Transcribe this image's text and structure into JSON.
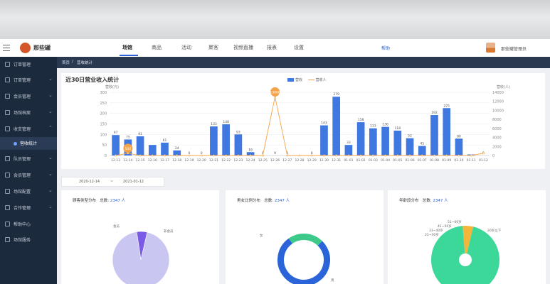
{
  "header": {
    "logo_text": "那些罐",
    "nav": [
      "场馆",
      "商品",
      "活动",
      "聚客",
      "视频直播",
      "报表",
      "设置"
    ],
    "active_nav": 0,
    "help": "帮助",
    "username": "那些罐管理员"
  },
  "sidebar": {
    "items": [
      {
        "label": "订单管理",
        "chevron": false
      },
      {
        "label": "订单管理",
        "chevron": true
      },
      {
        "label": "会员管理",
        "chevron": true
      },
      {
        "label": "场馆档案",
        "chevron": true
      },
      {
        "label": "收支管理",
        "chevron": true
      },
      {
        "label": "营收统计",
        "sub": true
      },
      {
        "label": "队员管理",
        "chevron": true
      },
      {
        "label": "会员管理",
        "chevron": true
      },
      {
        "label": "场馆配置",
        "chevron": true
      },
      {
        "label": "合作管理",
        "chevron": true
      },
      {
        "label": "帮助中心",
        "chevron": false
      },
      {
        "label": "场馆服务",
        "chevron": false
      }
    ]
  },
  "breadcrumb": [
    "首页",
    "营收统计"
  ],
  "main": {
    "title": "近30日营业收入统计",
    "legend": [
      "营收",
      "营收人"
    ],
    "left_unit": "营收(元)",
    "right_unit": "营收(人)"
  },
  "chart_data": {
    "type": "bar",
    "categories": [
      "12-13",
      "12-14",
      "12-15",
      "12-16",
      "12-17",
      "12-18",
      "12-19",
      "12-20",
      "12-21",
      "12-22",
      "12-23",
      "12-24",
      "12-25",
      "12-26",
      "12-27",
      "12-28",
      "12-29",
      "12-30",
      "12-31",
      "01-01",
      "01-02",
      "01-03",
      "01-04",
      "01-05",
      "01-06",
      "01-07",
      "01-08",
      "01-09",
      "01-10",
      "01-11",
      "01-12"
    ],
    "series": [
      {
        "name": "营收",
        "axis": "left",
        "values": [
          97,
          76,
          91,
          50,
          61,
          24,
          0,
          0,
          138,
          148,
          100,
          16,
          0,
          0,
          0,
          0,
          0,
          143,
          279,
          50,
          158,
          129,
          136,
          118,
          82,
          45,
          192,
          225,
          80,
          5,
          0
        ],
        "labels": [
          "97",
          "75",
          "91",
          "",
          "61",
          "24",
          "0",
          "0",
          "133",
          "148",
          "93",
          "16",
          "0",
          "9",
          "0",
          "",
          "8",
          "143",
          "279",
          "33",
          "158",
          "113",
          "136",
          "118",
          "52",
          "45",
          "192",
          "225",
          "80",
          "",
          "0"
        ]
      },
      {
        "name": "营收人",
        "axis": "right",
        "values": [
          0,
          500,
          0,
          0,
          0,
          0,
          0,
          0,
          0,
          0,
          0,
          0,
          0,
          13000,
          0,
          0,
          0,
          0,
          0,
          0,
          0,
          0,
          0,
          0,
          0,
          0,
          0,
          0,
          0,
          0,
          500
        ]
      }
    ],
    "ylim_left": [
      0,
      300
    ],
    "left_ticks": [
      "0",
      "50",
      "100",
      "150",
      "200",
      "250",
      "300"
    ],
    "ylim_right": [
      0,
      14000
    ],
    "right_ticks": [
      "0",
      "2000",
      "4000",
      "6000",
      "8000",
      "10000",
      "12000",
      "14000"
    ],
    "highlight": [
      {
        "index": 1,
        "label": "500"
      },
      {
        "index": 13,
        "label": "13000"
      }
    ]
  },
  "date_range": {
    "start": "2020-12-14",
    "separator": "~",
    "end": "2021-01-12"
  },
  "panels": [
    {
      "title": "顾客类型分布",
      "total_label": "总数:",
      "total": "2347 人",
      "labels": [
        "会员",
        "非会员"
      ],
      "colors": [
        "#7b5be6",
        "#c9c7f2"
      ],
      "values": [
        6,
        94
      ]
    },
    {
      "title": "男女比例分布",
      "total_label": "总数:",
      "total": "2347 人",
      "labels": [
        "女",
        "男"
      ],
      "colors": [
        "#3cc98a",
        "#2a64d8"
      ],
      "values": [
        22,
        78
      ]
    },
    {
      "title": "年龄段分布",
      "total_label": "总数:",
      "total": "2347 人",
      "labels": [
        "51~60岁",
        "41~50岁",
        "31~40岁",
        "21~30岁",
        "20岁以下",
        "20以下"
      ],
      "colors": [
        "#f3b63a",
        "#3cd89a"
      ],
      "values": [
        5,
        95
      ]
    }
  ]
}
